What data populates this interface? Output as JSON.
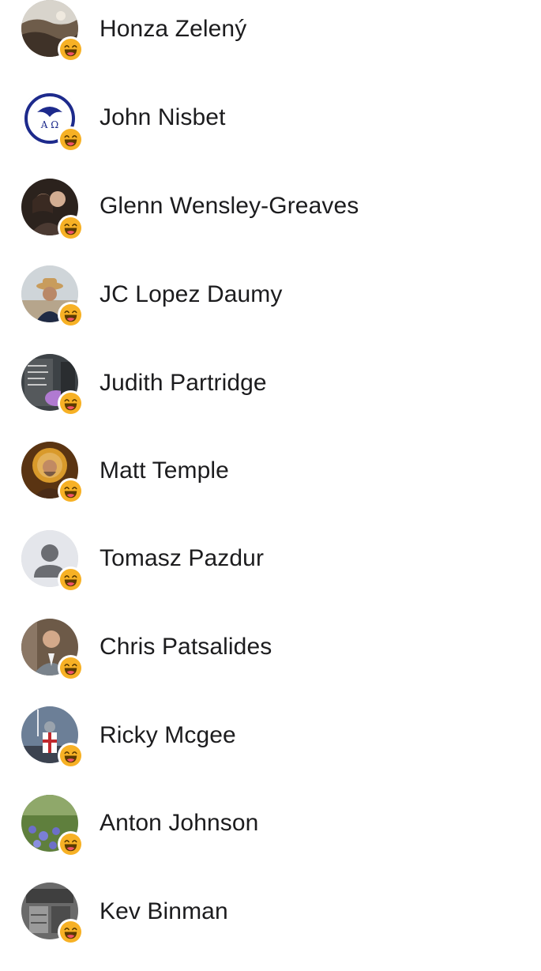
{
  "reaction": {
    "icon": "haha-reaction-icon",
    "color": "#f7b125"
  },
  "people": [
    {
      "name": "Honza Zelený",
      "avatar": "landscape-photo"
    },
    {
      "name": "John Nisbet",
      "avatar": "alpha-omega-logo"
    },
    {
      "name": "Glenn Wensley-Greaves",
      "avatar": "couple-photo"
    },
    {
      "name": "JC Lopez Daumy",
      "avatar": "man-in-hat-photo"
    },
    {
      "name": "Judith Partridge",
      "avatar": "memorial-stone-photo"
    },
    {
      "name": "Matt Temple",
      "avatar": "saint-icon-painting"
    },
    {
      "name": "Tomasz Pazdur",
      "avatar": "default-silhouette"
    },
    {
      "name": "Chris Patsalides",
      "avatar": "man-in-suit-photo"
    },
    {
      "name": "Ricky Mcgee",
      "avatar": "knight-photo"
    },
    {
      "name": "Anton Johnson",
      "avatar": "bluebells-photo"
    },
    {
      "name": "Kev Binman",
      "avatar": "shop-photo"
    }
  ]
}
